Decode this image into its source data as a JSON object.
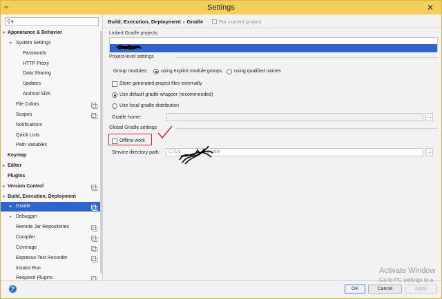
{
  "window": {
    "title": "Settings",
    "close_label": "✕"
  },
  "search": {
    "placeholder": "",
    "value": ""
  },
  "tree": [
    {
      "label": "Appearance & Behavior",
      "bold": true,
      "arrow": "▾",
      "level": 0,
      "copy": false
    },
    {
      "label": "System Settings",
      "bold": false,
      "arrow": "▾",
      "level": 1,
      "copy": false
    },
    {
      "label": "Passwords",
      "bold": false,
      "arrow": "",
      "level": 2,
      "copy": false
    },
    {
      "label": "HTTP Proxy",
      "bold": false,
      "arrow": "",
      "level": 2,
      "copy": false
    },
    {
      "label": "Data Sharing",
      "bold": false,
      "arrow": "",
      "level": 2,
      "copy": false
    },
    {
      "label": "Updates",
      "bold": false,
      "arrow": "",
      "level": 2,
      "copy": false
    },
    {
      "label": "Android SDK",
      "bold": false,
      "arrow": "",
      "level": 2,
      "copy": false
    },
    {
      "label": "File Colors",
      "bold": false,
      "arrow": "",
      "level": 1,
      "copy": true
    },
    {
      "label": "Scopes",
      "bold": false,
      "arrow": "",
      "level": 1,
      "copy": true
    },
    {
      "label": "Notifications",
      "bold": false,
      "arrow": "",
      "level": 1,
      "copy": false
    },
    {
      "label": "Quick Lists",
      "bold": false,
      "arrow": "",
      "level": 1,
      "copy": false
    },
    {
      "label": "Path Variables",
      "bold": false,
      "arrow": "",
      "level": 1,
      "copy": false
    },
    {
      "label": "Keymap",
      "bold": true,
      "arrow": "",
      "level": 0,
      "copy": false
    },
    {
      "label": "Editor",
      "bold": true,
      "arrow": "▸",
      "level": 0,
      "copy": false
    },
    {
      "label": "Plugins",
      "bold": true,
      "arrow": "",
      "level": 0,
      "copy": false
    },
    {
      "label": "Version Control",
      "bold": true,
      "arrow": "▸",
      "level": 0,
      "copy": true
    },
    {
      "label": "Build, Execution, Deployment",
      "bold": true,
      "arrow": "▾",
      "level": 0,
      "copy": false
    },
    {
      "label": "Gradle",
      "bold": false,
      "arrow": "▸",
      "level": 1,
      "copy": true,
      "selected": true
    },
    {
      "label": "Debugger",
      "bold": false,
      "arrow": "▸",
      "level": 1,
      "copy": false
    },
    {
      "label": "Remote Jar Repositories",
      "bold": false,
      "arrow": "",
      "level": 1,
      "copy": true
    },
    {
      "label": "Compiler",
      "bold": false,
      "arrow": "",
      "level": 1,
      "copy": true
    },
    {
      "label": "Coverage",
      "bold": false,
      "arrow": "",
      "level": 1,
      "copy": true
    },
    {
      "label": "Espresso Test Recorder",
      "bold": false,
      "arrow": "",
      "level": 1,
      "copy": true
    },
    {
      "label": "Instant Run",
      "bold": false,
      "arrow": "",
      "level": 1,
      "copy": false
    },
    {
      "label": "Required Plugins",
      "bold": false,
      "arrow": "",
      "level": 1,
      "copy": true
    }
  ],
  "breadcrumb": {
    "parent": "Build, Execution, Deployment",
    "sep": "›",
    "current": "Gradle",
    "scope": "For current project"
  },
  "sections": {
    "linked": "Linked Gradle projects",
    "project_level": "Project-level settings",
    "global": "Global Gradle settings"
  },
  "group_modules": {
    "label": "Group modules:",
    "opt1": "using explicit module groups",
    "opt2": "using qualified names"
  },
  "store_generated": "Store generated project files externally",
  "default_wrapper": "Use default gradle wrapper (recommended)",
  "local_distribution": "Use local gradle distribution",
  "gradle_home": {
    "label": "Gradle home:",
    "value": ""
  },
  "offline_work": "Offline work",
  "service_dir": {
    "label": "Service directory path:",
    "value_start": "C:/Us",
    "value_end": "gradle"
  },
  "browse_label": "...",
  "footer": {
    "ok": "OK",
    "cancel": "Cancel",
    "apply": "Apply",
    "help": "?"
  },
  "watermark": {
    "line1": "Activate Window",
    "line2": "Go to PC settings to a"
  },
  "colors": {
    "selection": "#2f65ca",
    "title_bar": "#f4cf5c",
    "annotation": "#e02020"
  }
}
